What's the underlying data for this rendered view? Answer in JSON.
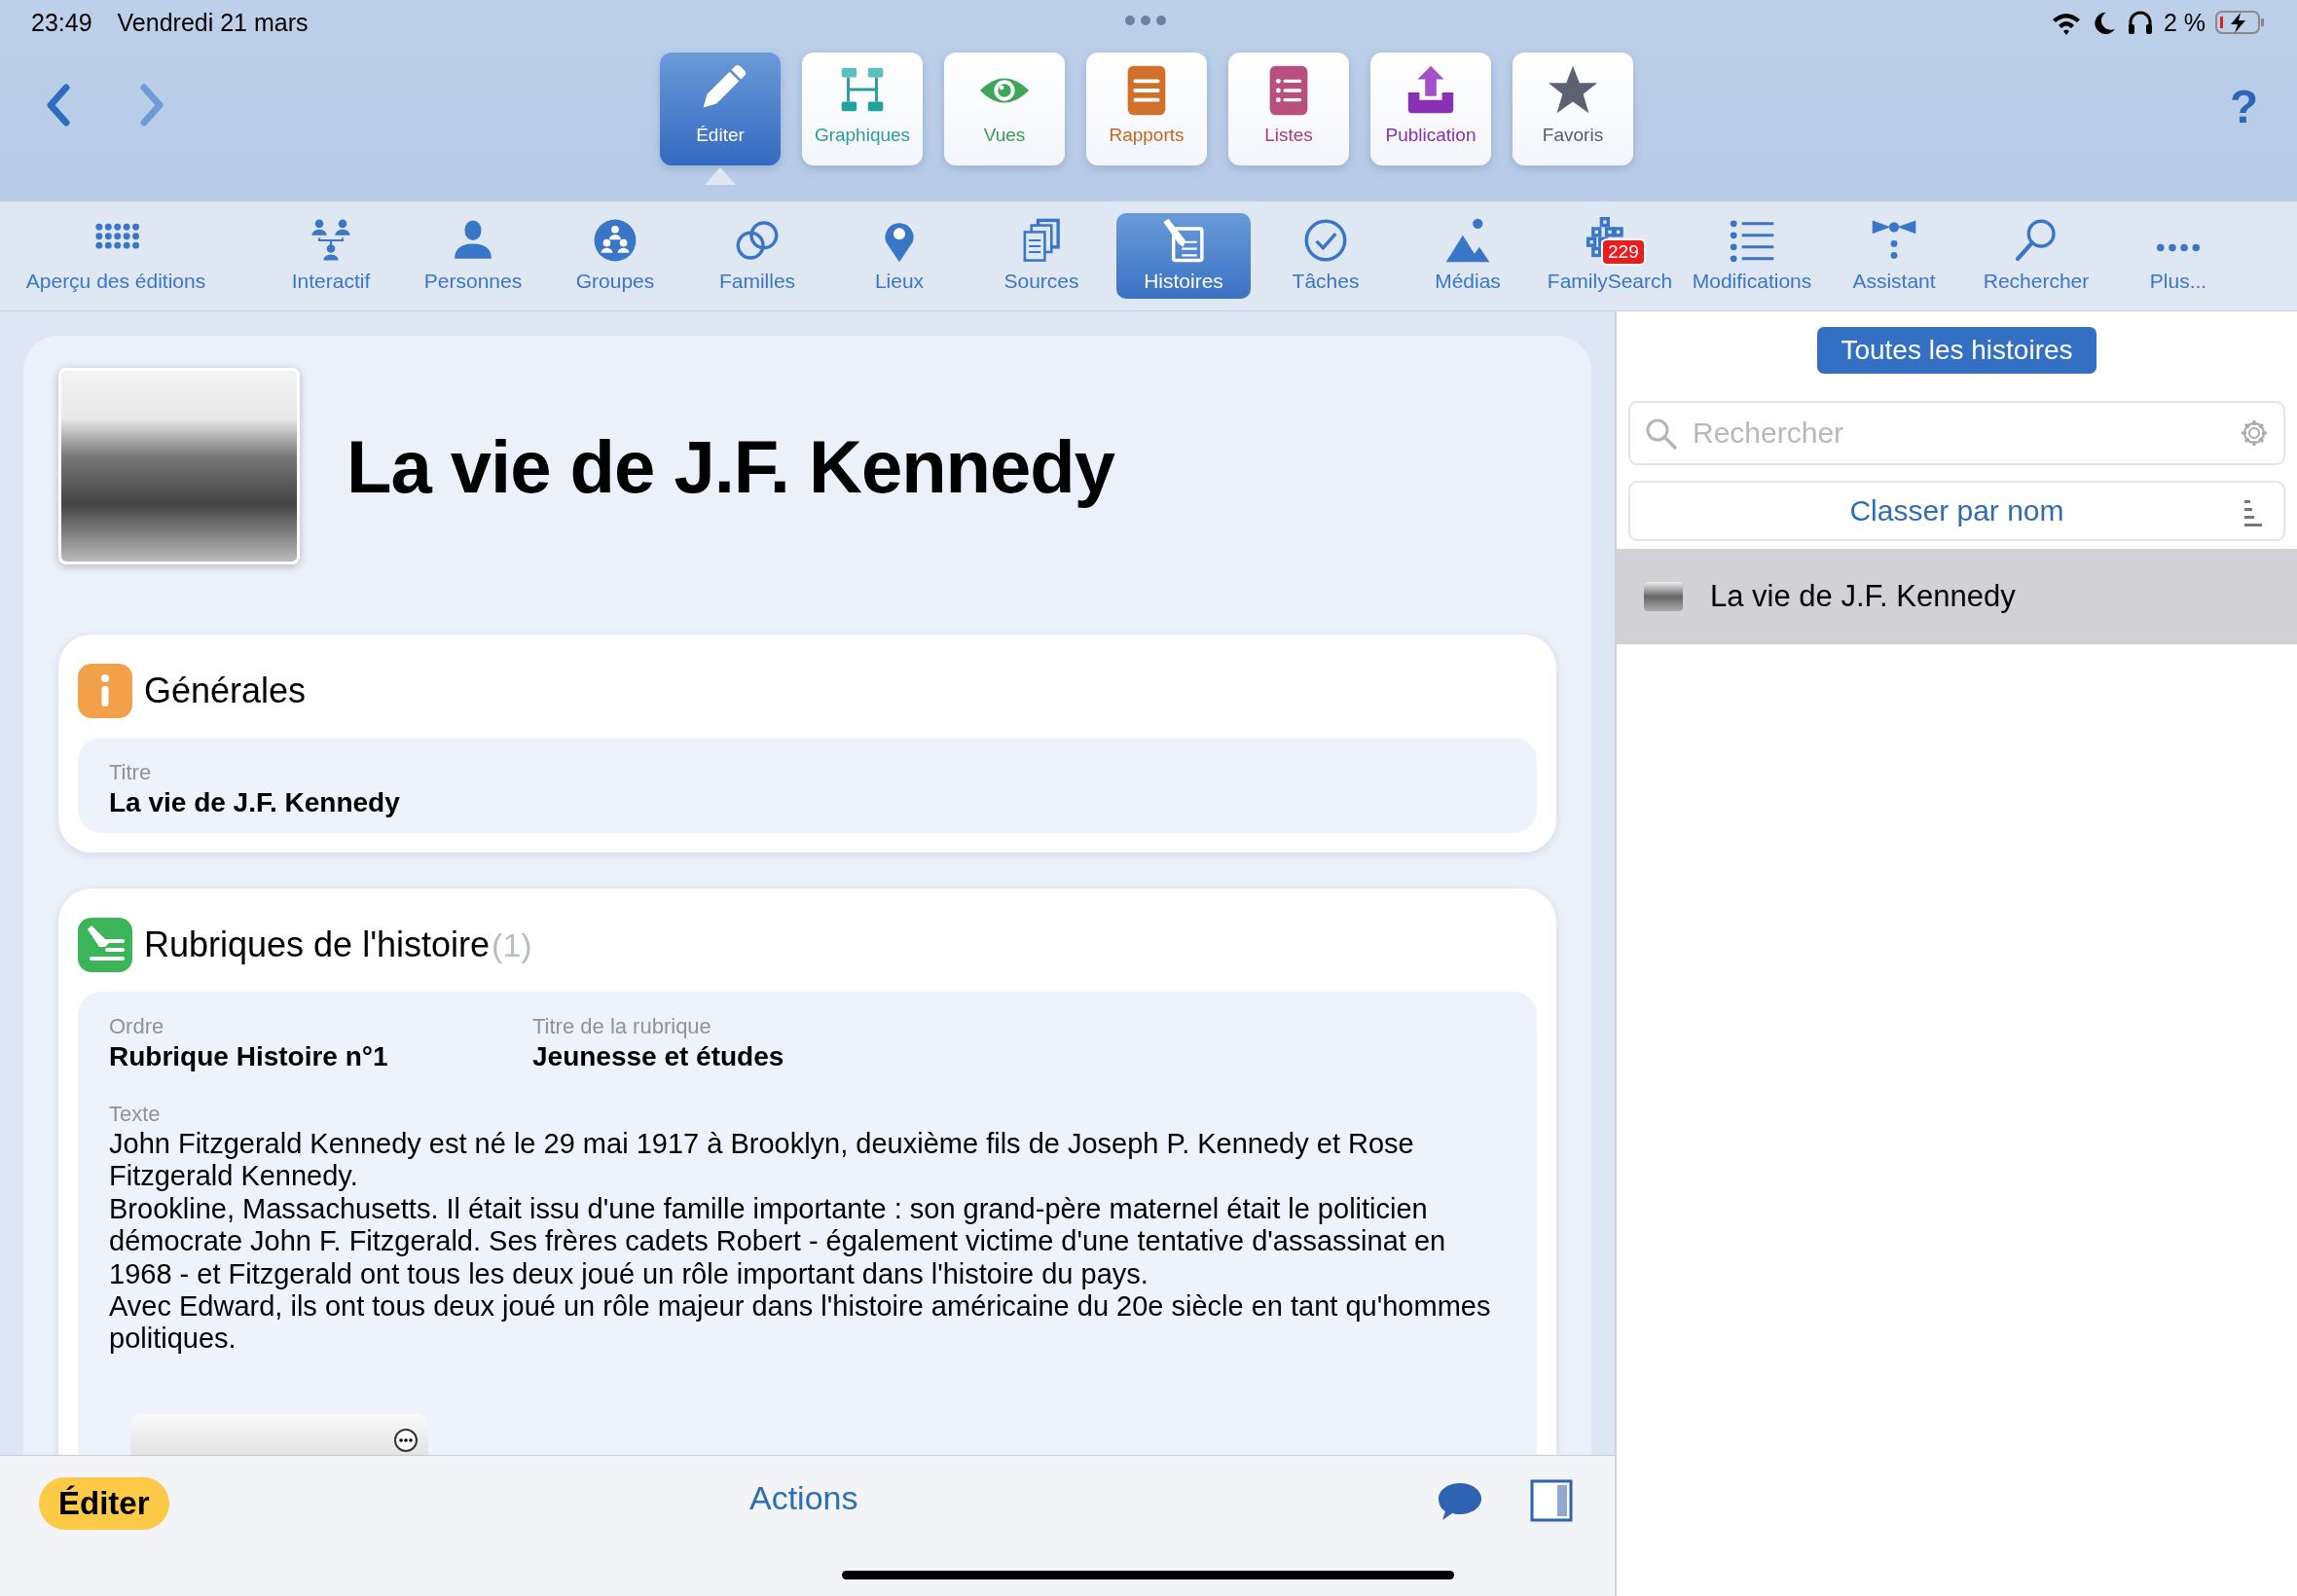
{
  "status_bar": {
    "time": "23:49",
    "date": "Vendredi 21 mars",
    "battery": "2 %"
  },
  "help_button": "?",
  "app_tabs": [
    {
      "label": "Éditer",
      "selected": true
    },
    {
      "label": "Graphiques",
      "selected": false
    },
    {
      "label": "Vues",
      "selected": false
    },
    {
      "label": "Rapports",
      "selected": false
    },
    {
      "label": "Listes",
      "selected": false
    },
    {
      "label": "Publication",
      "selected": false
    },
    {
      "label": "Favoris",
      "selected": false
    }
  ],
  "toolbar": [
    {
      "label": "Aperçu des éditions",
      "selected": false
    },
    {
      "label": "Interactif",
      "selected": false
    },
    {
      "label": "Personnes",
      "selected": false
    },
    {
      "label": "Groupes",
      "selected": false
    },
    {
      "label": "Familles",
      "selected": false
    },
    {
      "label": "Lieux",
      "selected": false
    },
    {
      "label": "Sources",
      "selected": false
    },
    {
      "label": "Histoires",
      "selected": true
    },
    {
      "label": "Tâches",
      "selected": false
    },
    {
      "label": "Médias",
      "selected": false
    },
    {
      "label": "FamilySearch",
      "selected": false,
      "badge": "229"
    },
    {
      "label": "Modifications",
      "selected": false
    },
    {
      "label": "Assistant",
      "selected": false
    },
    {
      "label": "Rechercher",
      "selected": false
    },
    {
      "label": "Plus...",
      "selected": false
    }
  ],
  "story": {
    "title": "La vie de J.F. Kennedy",
    "general": {
      "heading": "Générales",
      "field_label": "Titre",
      "field_value": "La vie de J.F. Kennedy"
    },
    "sections": {
      "heading": "Rubriques de l'histoire",
      "count": "(1)",
      "order_label": "Ordre",
      "order_value": "Rubrique Histoire n°1",
      "title_label": "Titre de la rubrique",
      "title_value": "Jeunesse et études",
      "text_label": "Texte",
      "text": "John Fitzgerald Kennedy est né le 29 mai 1917 à Brooklyn, deuxième fils de Joseph P. Kennedy et Rose Fitzgerald Kennedy.\nBrookline, Massachusetts. Il était issu d'une famille importante : son grand-père maternel était le politicien démocrate John F. Fitzgerald. Ses frères cadets Robert - également victime d'une tentative d'assassinat en 1968 - et Fitzgerald ont tous les deux joué un rôle important dans l'histoire du pays.\nAvec Edward, ils ont tous deux joué un rôle majeur dans l'histoire américaine du 20e siècle en tant qu'hommes politiques."
    }
  },
  "bottom_bar": {
    "edit_button": "Éditer",
    "actions": "Actions"
  },
  "side_panel": {
    "filter_button": "Toutes les histoires",
    "search": {
      "placeholder": "Rechercher"
    },
    "sort_button": "Classer par nom",
    "items": [
      {
        "label": "La vie de J.F. Kennedy",
        "selected": true
      }
    ]
  }
}
